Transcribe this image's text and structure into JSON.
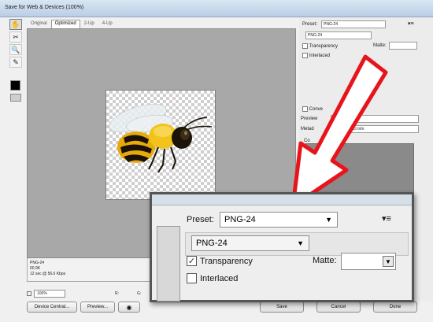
{
  "window": {
    "title": "Save for Web & Devices (100%)"
  },
  "tabs": [
    "Original",
    "Optimized",
    "2-Up",
    "4-Up"
  ],
  "toolbar": {
    "tools": [
      "hand-tool",
      "slice-select-tool",
      "zoom-tool",
      "eyedropper-tool"
    ]
  },
  "preview_info": {
    "format": "PNG-24",
    "size": "60.9K",
    "time": "12 sec @ 56.6 Kbps"
  },
  "zoom": {
    "value": "100%",
    "r_label": "R:",
    "g_label": "G:"
  },
  "buttons": {
    "device_central": "Device Central...",
    "preview": "Preview...",
    "save": "Save",
    "cancel": "Cancel",
    "done": "Done"
  },
  "settings": {
    "preset_label": "Preset:",
    "preset_value": "PNG-24",
    "format_value": "PNG-24",
    "transparency_label": "Transparency",
    "transparency_checked": true,
    "interlaced_label": "Interlaced",
    "interlaced_checked": false,
    "matte_label": "Matte:",
    "convert_label": "Conve",
    "preview_label": "Preview",
    "metadata_label": "Metad",
    "metadata_value": "t and Contact Info",
    "color_label": "Co"
  },
  "colors": {
    "arrow_fill": "#ffffff",
    "arrow_stroke": "#e8141b"
  }
}
